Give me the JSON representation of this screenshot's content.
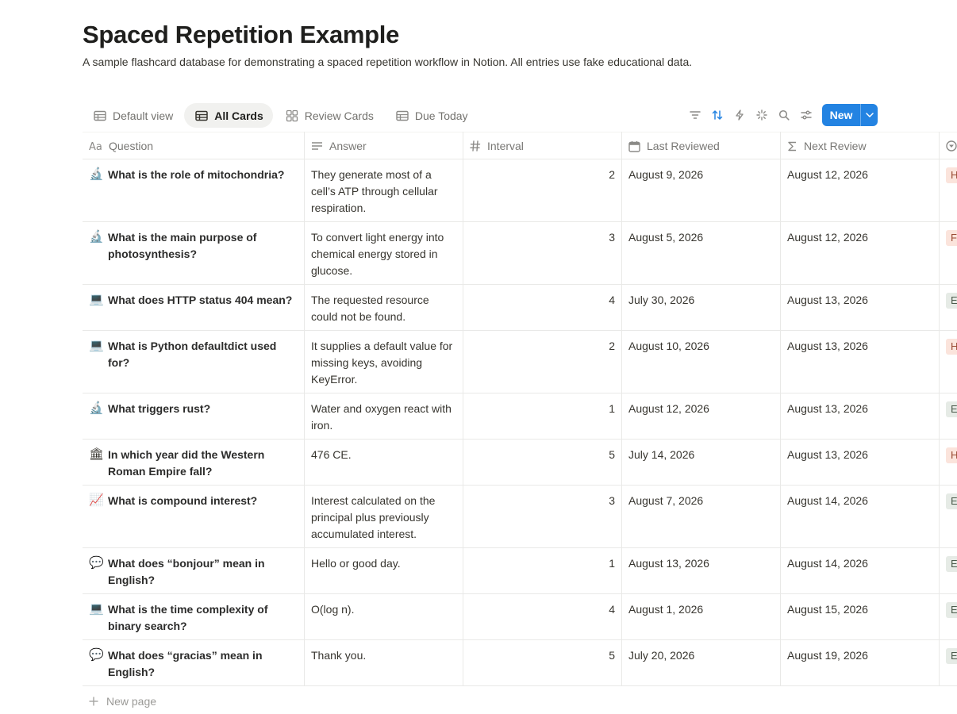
{
  "page": {
    "title": "Spaced Repetition Example",
    "description": "A sample flashcard database for demonstrating a spaced repetition workflow in Notion. All entries use fake educational data."
  },
  "views": [
    {
      "label": "Default view",
      "icon": "table-icon",
      "active": false
    },
    {
      "label": "All Cards",
      "icon": "table-icon",
      "active": true
    },
    {
      "label": "Review Cards",
      "icon": "gallery-icon",
      "active": false
    },
    {
      "label": "Due Today",
      "icon": "table-icon",
      "active": false
    }
  ],
  "toolbar": {
    "tools": [
      "filter-icon",
      "sort-icon",
      "automation-icon",
      "ai-sparkle-icon",
      "search-icon",
      "settings-sliders-icon"
    ],
    "new_label": "New",
    "accent": "#2383e2"
  },
  "columns": [
    {
      "label": "Question",
      "icon": "title-aa-icon"
    },
    {
      "label": "Answer",
      "icon": "text-lines-icon"
    },
    {
      "label": "Interval",
      "icon": "number-hash-icon"
    },
    {
      "label": "Last Reviewed",
      "icon": "calendar-icon"
    },
    {
      "label": "Next Review",
      "icon": "formula-sigma-icon"
    },
    {
      "label": "",
      "icon": "status-icon"
    }
  ],
  "rows": [
    {
      "emoji": "🔬",
      "emoji_name": "microscope-icon",
      "question": "What is the role of mitochondria?",
      "answer": "They generate most of a cell’s ATP through cellular respiration.",
      "interval": "2",
      "last_reviewed": "August 9, 2026",
      "next_review": "August 12, 2026",
      "tag": "H",
      "tag_color": "#fbe4dc"
    },
    {
      "emoji": "🔬",
      "emoji_name": "microscope-icon",
      "question": "What is the main purpose of photosynthesis?",
      "answer": "To convert light energy into chemical energy stored in glucose.",
      "interval": "3",
      "last_reviewed": "August 5, 2026",
      "next_review": "August 12, 2026",
      "tag": "F",
      "tag_color": "#fbe4dc"
    },
    {
      "emoji": "💻",
      "emoji_name": "laptop-icon",
      "question": "What does HTTP status 404 mean?",
      "answer": "The requested resource could not be found.",
      "interval": "4",
      "last_reviewed": "July 30, 2026",
      "next_review": "August 13, 2026",
      "tag": "E",
      "tag_color": "#e6ebe6"
    },
    {
      "emoji": "💻",
      "emoji_name": "laptop-icon",
      "question": "What is Python defaultdict used for?",
      "answer": "It supplies a default value for missing keys, avoiding KeyError.",
      "interval": "2",
      "last_reviewed": "August 10, 2026",
      "next_review": "August 13, 2026",
      "tag": "H",
      "tag_color": "#fbe4dc"
    },
    {
      "emoji": "🔬",
      "emoji_name": "microscope-icon",
      "question": "What triggers rust?",
      "answer": "Water and oxygen react with iron.",
      "interval": "1",
      "last_reviewed": "August 12, 2026",
      "next_review": "August 13, 2026",
      "tag": "E",
      "tag_color": "#e6ebe6"
    },
    {
      "emoji": "🏛",
      "emoji_name": "classical-building-icon",
      "question": "In which year did the Western Roman Empire fall?",
      "answer": "476 CE.",
      "interval": "5",
      "last_reviewed": "July 14, 2026",
      "next_review": "August 13, 2026",
      "tag": "H",
      "tag_color": "#fbe4dc"
    },
    {
      "emoji": "📈",
      "emoji_name": "chart-increasing-icon",
      "question": "What is compound interest?",
      "answer": "Interest calculated on the principal plus previously accumulated interest.",
      "interval": "3",
      "last_reviewed": "August 7, 2026",
      "next_review": "August 14, 2026",
      "tag": "E",
      "tag_color": "#e6ebe6"
    },
    {
      "emoji": "💬",
      "emoji_name": "speech-bubble-icon",
      "question": "What does “bonjour” mean in English?",
      "answer": "Hello or good day.",
      "interval": "1",
      "last_reviewed": "August 13, 2026",
      "next_review": "August 14, 2026",
      "tag": "E",
      "tag_color": "#e6ebe6"
    },
    {
      "emoji": "💻",
      "emoji_name": "laptop-icon",
      "question": "What is the time complexity of binary search?",
      "answer": "O(log n).",
      "interval": "4",
      "last_reviewed": "August 1, 2026",
      "next_review": "August 15, 2026",
      "tag": "E",
      "tag_color": "#e6ebe6"
    },
    {
      "emoji": "💬",
      "emoji_name": "speech-bubble-icon",
      "question": "What does “gracias” mean in English?",
      "answer": "Thank you.",
      "interval": "5",
      "last_reviewed": "July 20, 2026",
      "next_review": "August 19, 2026",
      "tag": "E",
      "tag_color": "#e6ebe6"
    }
  ],
  "footer": {
    "new_page_label": "New page"
  }
}
